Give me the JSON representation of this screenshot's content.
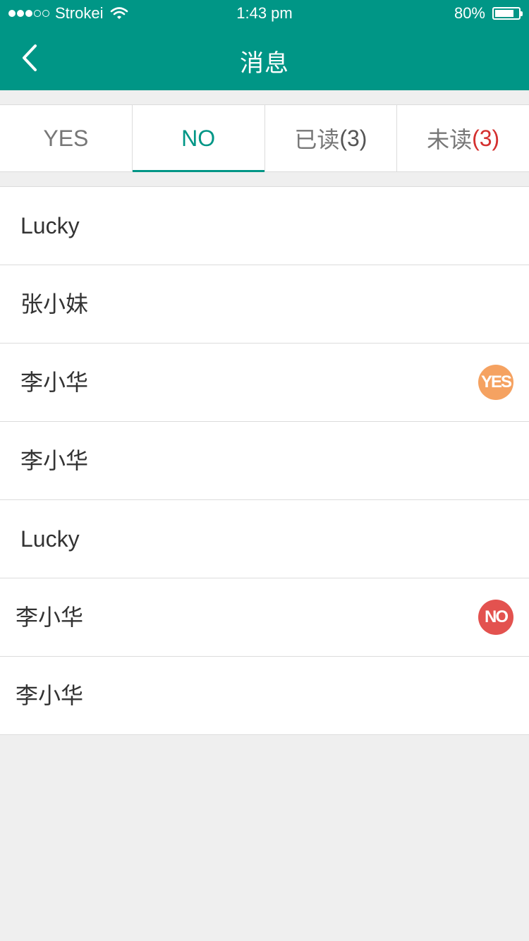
{
  "status_bar": {
    "carrier": "Strokei",
    "time": "1:43 pm",
    "battery": "80%",
    "battery_level": 0.8,
    "signal_bars_filled": 3,
    "signal_bars_total": 5
  },
  "nav": {
    "title": "消息",
    "back_icon": "chevron-left-icon"
  },
  "tabs": [
    {
      "label": "YES",
      "count": "",
      "active": false
    },
    {
      "label": "NO",
      "count": "",
      "active": true
    },
    {
      "label": "已读",
      "count": "(3)",
      "active": false
    },
    {
      "label": "未读",
      "count": "(3)",
      "active": false
    }
  ],
  "list": [
    {
      "name": "Lucky",
      "badge": ""
    },
    {
      "name": "张小妹",
      "badge": ""
    },
    {
      "name": "李小华",
      "badge": "YES"
    },
    {
      "name": "李小华",
      "badge": ""
    },
    {
      "name": "Lucky",
      "badge": ""
    },
    {
      "name": "李小华",
      "badge": "NO"
    },
    {
      "name": "李小华",
      "badge": ""
    }
  ],
  "colors": {
    "primary": "#009686",
    "badge_yes": "#f5a261",
    "badge_no": "#e3524f",
    "unread_count": "#d4302f"
  }
}
